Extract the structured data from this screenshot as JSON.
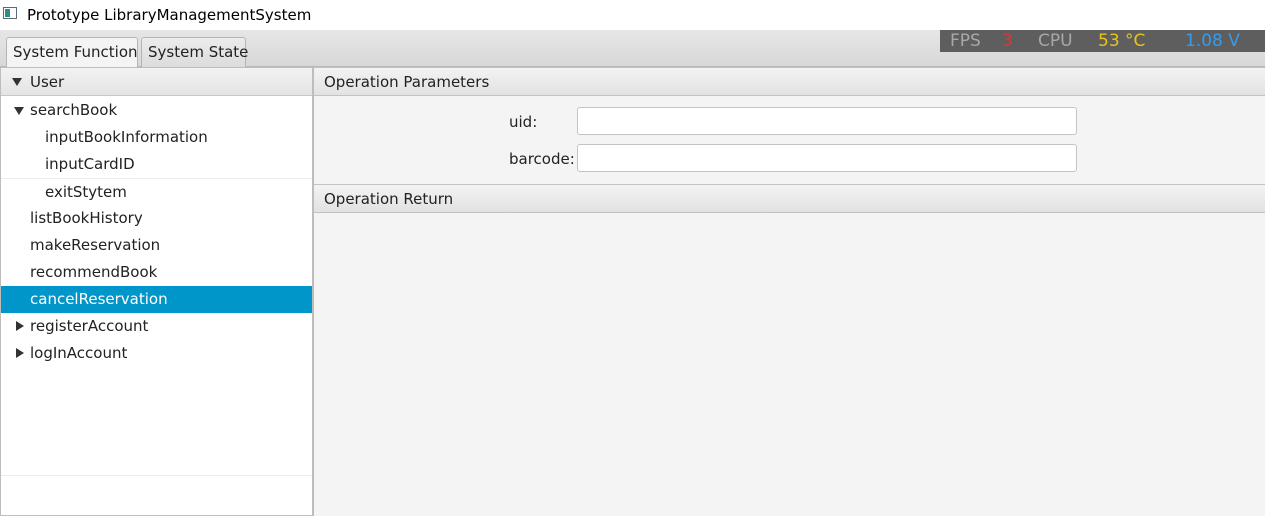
{
  "window": {
    "title": "Prototype LibraryManagementSystem"
  },
  "tabs": [
    {
      "label": "System Function",
      "active": true
    },
    {
      "label": "System State",
      "active": false
    }
  ],
  "status_bar": {
    "fps_label": "FPS",
    "fps_value": "3",
    "cpu_label": "CPU",
    "cpu_temp": "53 °C",
    "voltage": "1.08 V",
    "colors": {
      "fps_value": "#d23a3a",
      "cpu_temp": "#e8c31a",
      "voltage": "#3a9be8",
      "label": "#a8a8a8"
    }
  },
  "tree": {
    "root": "User",
    "items": [
      {
        "label": "searchBook",
        "expanded": true
      },
      {
        "label": "inputBookInformation"
      },
      {
        "label": "inputCardID"
      },
      {
        "label": "exitStytem"
      },
      {
        "label": "listBookHistory"
      },
      {
        "label": "makeReservation"
      },
      {
        "label": "recommendBook"
      },
      {
        "label": "cancelReservation",
        "selected": true
      },
      {
        "label": "registerAccount",
        "expanded": false
      },
      {
        "label": "logInAccount",
        "expanded": false
      }
    ]
  },
  "operation_parameters": {
    "title": "Operation Parameters",
    "fields": [
      {
        "label": "uid:",
        "value": "",
        "placeholder": ""
      },
      {
        "label": "barcode:",
        "value": "",
        "placeholder": ""
      }
    ]
  },
  "operation_return": {
    "title": "Operation Return"
  },
  "accent_color": "#0096c9"
}
